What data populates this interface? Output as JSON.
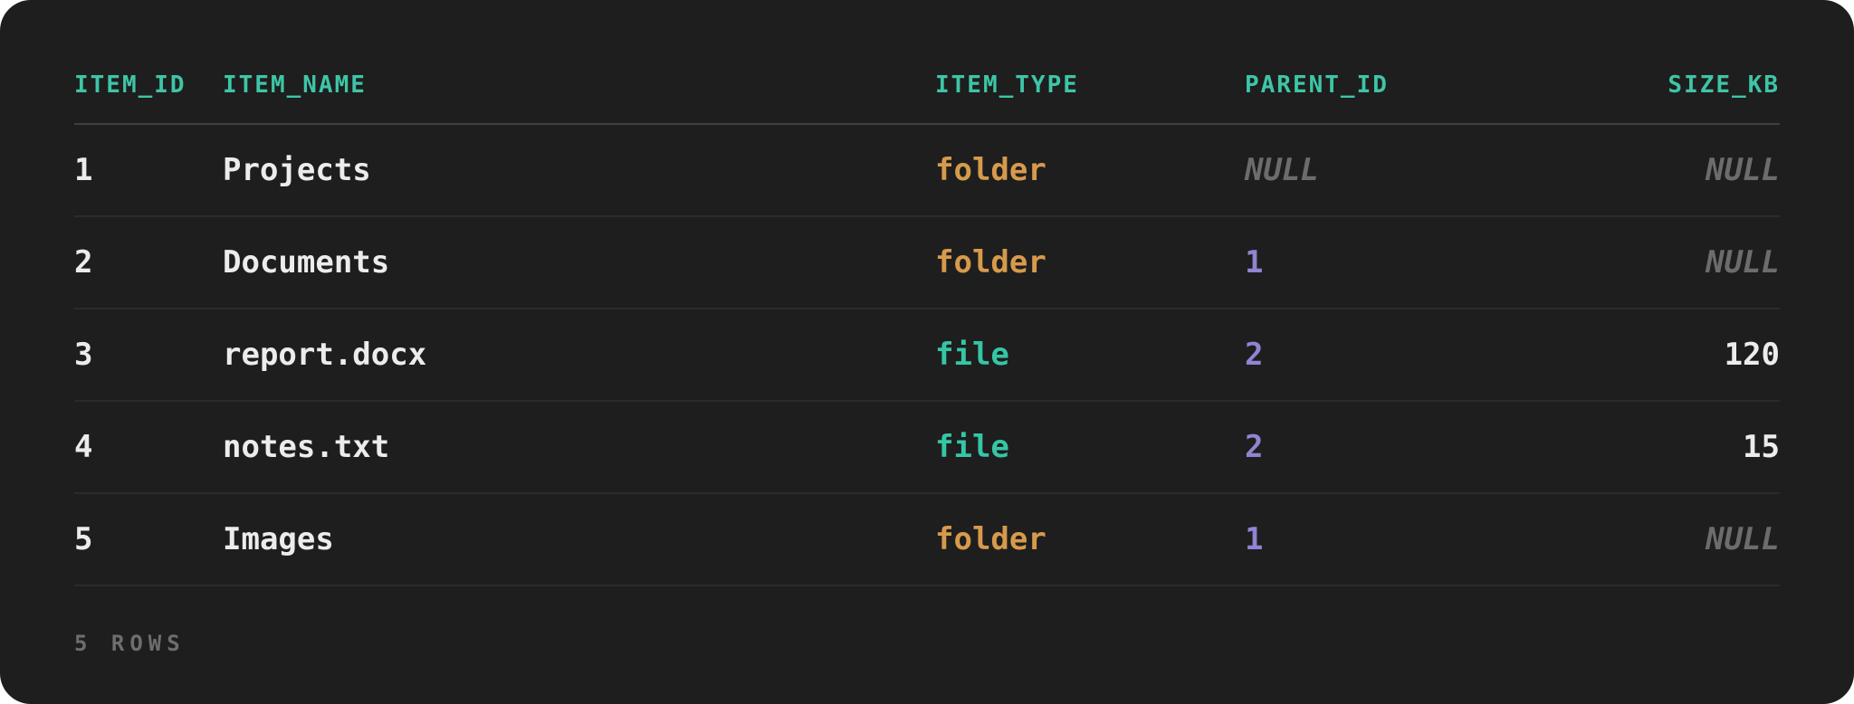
{
  "table": {
    "columns": [
      "ITEM_ID",
      "ITEM_NAME",
      "ITEM_TYPE",
      "PARENT_ID",
      "SIZE_KB"
    ],
    "rows": [
      {
        "item_id": "1",
        "item_name": "Projects",
        "item_type": "folder",
        "parent_id": "NULL",
        "size_kb": "NULL"
      },
      {
        "item_id": "2",
        "item_name": "Documents",
        "item_type": "folder",
        "parent_id": "1",
        "size_kb": "NULL"
      },
      {
        "item_id": "3",
        "item_name": "report.docx",
        "item_type": "file",
        "parent_id": "2",
        "size_kb": "120"
      },
      {
        "item_id": "4",
        "item_name": "notes.txt",
        "item_type": "file",
        "parent_id": "2",
        "size_kb": "15"
      },
      {
        "item_id": "5",
        "item_name": "Images",
        "item_type": "folder",
        "parent_id": "1",
        "size_kb": "NULL"
      }
    ]
  },
  "footer": {
    "row_count": "5 ROWS"
  },
  "colors": {
    "background": "#1e1e1e",
    "header": "#3ec5a7",
    "folder": "#d79a4c",
    "file": "#35c6a6",
    "reference_number": "#9283d3",
    "null": "#6c6c6c",
    "text": "#ececec"
  }
}
